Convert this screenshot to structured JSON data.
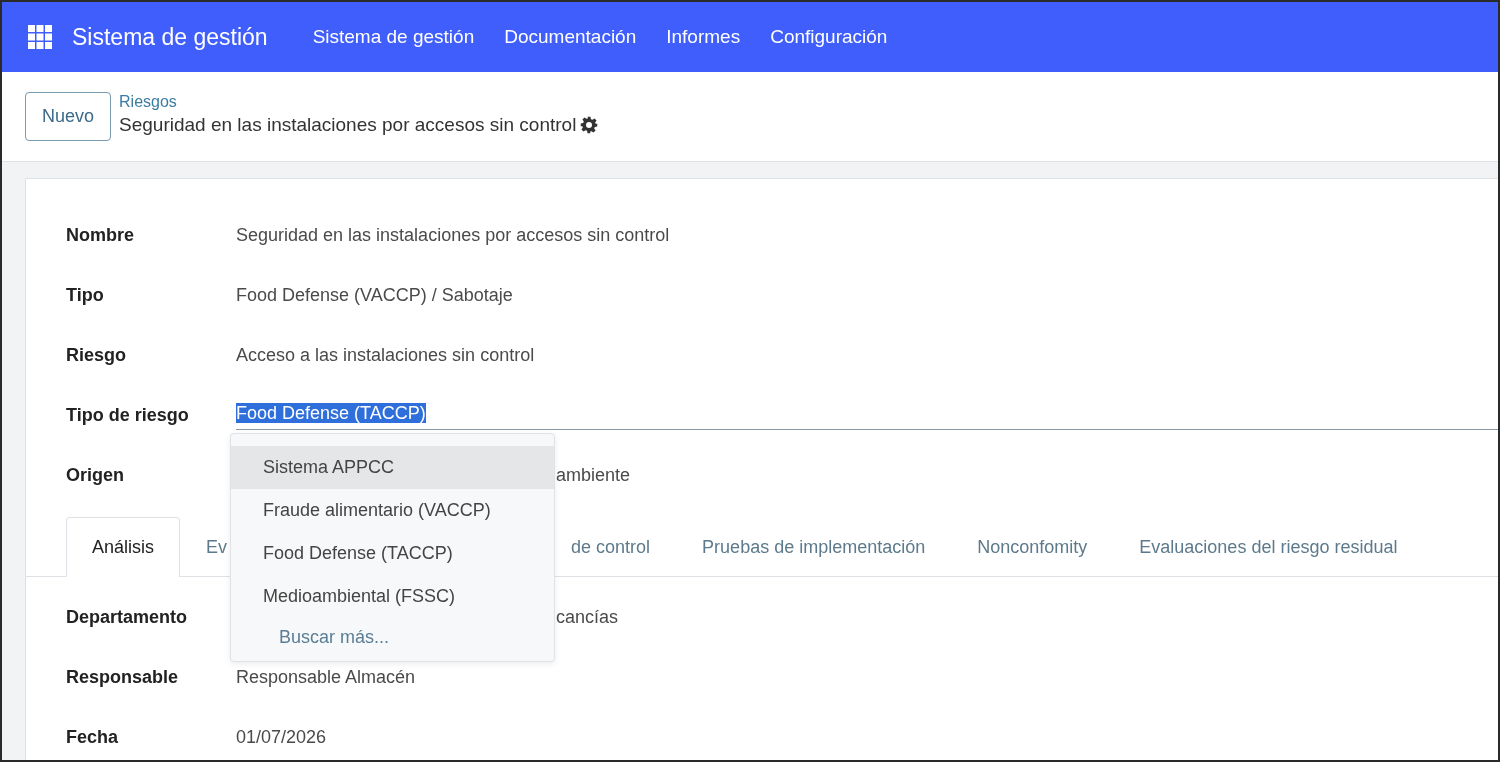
{
  "app": {
    "title": "Sistema de gestión"
  },
  "menu": [
    {
      "label": "Sistema de gestión"
    },
    {
      "label": "Documentación"
    },
    {
      "label": "Informes"
    },
    {
      "label": "Configuración"
    }
  ],
  "control_panel": {
    "new_button": "Nuevo",
    "breadcrumb": "Riesgos",
    "record_title": "Seguridad en las instalaciones por accesos sin control"
  },
  "fields": [
    {
      "label": "Nombre",
      "value": "Seguridad en las instalaciones por accesos sin control",
      "kind": "text"
    },
    {
      "label": "Tipo",
      "value": "Food Defense (VACCP) / Sabotaje",
      "kind": "text"
    },
    {
      "label": "Riesgo",
      "value": "Acceso a las instalaciones sin control",
      "kind": "text"
    },
    {
      "label": "Tipo de riesgo",
      "value": "Food Defense (TACCP)",
      "kind": "input"
    },
    {
      "label": "Origen",
      "value": "ambiente",
      "kind": "partial"
    }
  ],
  "tabs": [
    {
      "label": "Análisis",
      "selected": true,
      "kind": "full"
    },
    {
      "label": "Ev",
      "selected": false,
      "kind": "head"
    },
    {
      "label": "de control",
      "selected": false,
      "kind": "tail"
    },
    {
      "label": "Pruebas de implementación",
      "selected": false,
      "kind": "full"
    },
    {
      "label": "Nonconfomity",
      "selected": false,
      "kind": "full"
    },
    {
      "label": "Evaluaciones del riesgo residual",
      "selected": false,
      "kind": "full"
    }
  ],
  "tab_fields": [
    {
      "label": "Departamento",
      "value": "cancías",
      "kind": "partial"
    },
    {
      "label": "Responsable",
      "value": "Responsable Almacén",
      "kind": "text"
    },
    {
      "label": "Fecha",
      "value": "01/07/2026",
      "kind": "text"
    }
  ],
  "dropdown": {
    "options": [
      {
        "label": "Sistema APPCC",
        "selected": true
      },
      {
        "label": "Fraude alimentario (VACCP)",
        "selected": false
      },
      {
        "label": "Food Defense (TACCP)",
        "selected": false
      },
      {
        "label": "Medioambiental (FSSC)",
        "selected": false
      }
    ],
    "search_more": "Buscar más..."
  }
}
